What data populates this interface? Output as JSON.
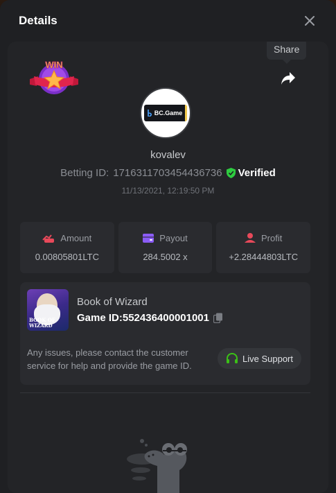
{
  "modal": {
    "title": "Details",
    "close_icon": "close-icon"
  },
  "share": {
    "tooltip": "Share",
    "icon": "share-arrow-icon"
  },
  "badge": {
    "text": "WIN",
    "icon": "win-star-badge-icon"
  },
  "avatar": {
    "brand": "BC.Game",
    "icon": "bc-game-logo-icon"
  },
  "user": {
    "name": "kovalev",
    "betting_label": "Betting ID:",
    "betting_id": "1716311703454436736",
    "verified_label": "Verified",
    "timestamp": "11/13/2021, 12:19:50 PM"
  },
  "stats": [
    {
      "label": "Amount",
      "value": "0.00805801LTC",
      "icon": "amount-icon",
      "color": "#e8495a"
    },
    {
      "label": "Payout",
      "value": "284.5002 x",
      "icon": "wallet-icon",
      "color": "#8b5cf6"
    },
    {
      "label": "Profit",
      "value": "+2.28444803LTC",
      "icon": "profit-icon",
      "color": "#e8495a"
    }
  ],
  "game": {
    "name": "Book of Wizard",
    "id_label": "Game ID:",
    "id_value": "552436400001001",
    "thumb_text_line1": "BOOK OF",
    "thumb_text_line2": "WIZARD"
  },
  "support": {
    "text": "Any issues, please contact the customer service for help and provide the game ID.",
    "button_label": "Live Support",
    "icon": "headset-icon"
  },
  "colors": {
    "verified_green": "#2ecc40",
    "accent_green": "#3bc117"
  }
}
